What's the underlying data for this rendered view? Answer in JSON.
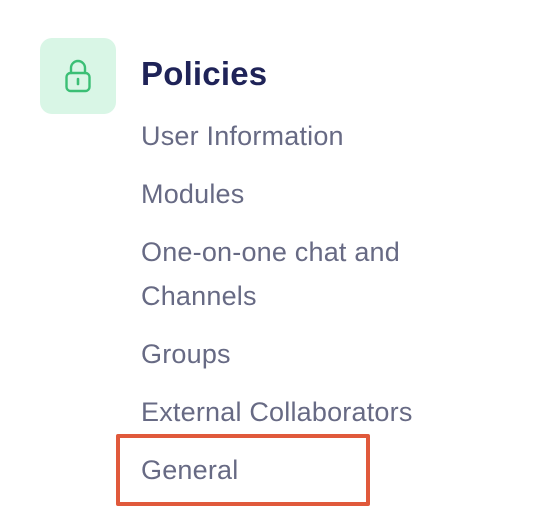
{
  "section": {
    "icon": "lock-icon",
    "icon_color": "#3bbf75",
    "icon_bg": "#d9f6e6",
    "title": "Policies",
    "title_color": "#1f2358",
    "items": [
      {
        "label": "User Information"
      },
      {
        "label": "Modules"
      },
      {
        "label": "One-on-one chat and Channels"
      },
      {
        "label": "Groups"
      },
      {
        "label": "External Collaborators"
      },
      {
        "label": "General"
      }
    ],
    "item_color": "#676a84",
    "highlight": {
      "target": "General",
      "color": "#e0593b"
    }
  }
}
